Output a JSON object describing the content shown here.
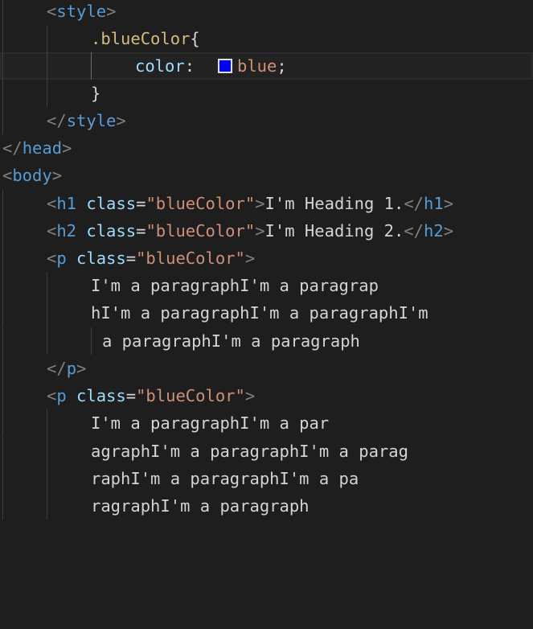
{
  "editor": {
    "swatch_color": "#0000ff",
    "lines": {
      "l1": {
        "open": "<",
        "tag": "style",
        "close": ">"
      },
      "l2": {
        "selector": ".blueColor",
        "brace": "{"
      },
      "l3": {
        "prop": "color",
        "colon": ":",
        "value": "blue",
        "semi": ";"
      },
      "l4": {
        "brace": "}"
      },
      "l5": {
        "open": "</",
        "tag": "style",
        "close": ">"
      },
      "l6": {
        "open": "</",
        "tag": "head",
        "close": ">"
      },
      "l7": {
        "open": "<",
        "tag": "body",
        "close": ">"
      },
      "l8": {
        "open": "<",
        "tag": "h1",
        "attr": "class",
        "eq": "=",
        "str": "\"blueColor\"",
        "close": ">",
        "text": "I'm Heading 1.",
        "end_open": "</",
        "end_tag": "h1",
        "end_close": ">"
      },
      "l9": {
        "open": "<",
        "tag": "h2",
        "attr": "class",
        "eq": "=",
        "str": "\"blueColor\"",
        "close": ">",
        "text": "I'm Heading 2.",
        "end_open": "</",
        "end_tag": "h2",
        "end_close": ">"
      },
      "l10": {
        "open": "<",
        "tag": "p",
        "attr": "class",
        "eq": "=",
        "str": "\"blueColor\"",
        "close": ">"
      },
      "l11": {
        "text": "I'm a paragraphI'm a paragrap"
      },
      "l12": {
        "text": "hI'm a paragraphI'm a paragraphI'm"
      },
      "l13": {
        "text": "a paragraphI'm a paragraph"
      },
      "l14": {
        "open": "</",
        "tag": "p",
        "close": ">"
      },
      "l15": {
        "open": "<",
        "tag": "p",
        "attr": "class",
        "eq": "=",
        "str": "\"blueColor\"",
        "close": ">"
      },
      "l16": {
        "text": "I'm a paragraphI'm a par"
      },
      "l17": {
        "text": "agraphI'm a paragraphI'm a parag"
      },
      "l18": {
        "text": "raphI'm a paragraphI'm a pa"
      },
      "l19": {
        "text": "ragraphI'm a paragraph"
      }
    }
  }
}
